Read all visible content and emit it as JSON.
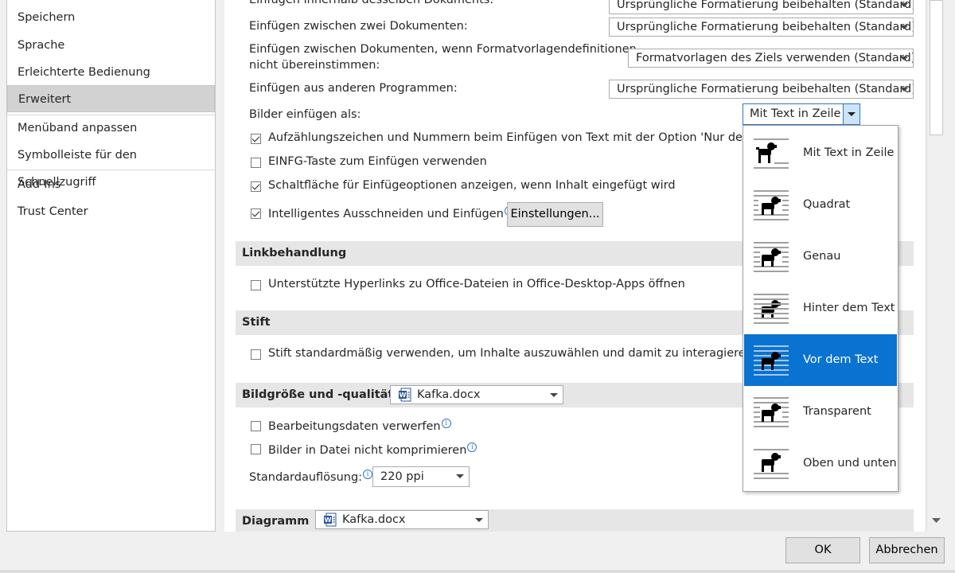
{
  "sidebar": {
    "items": [
      {
        "label": "Speichern"
      },
      {
        "label": "Sprache"
      },
      {
        "label": "Erleichterte Bedienung"
      },
      {
        "label": "Erweitert",
        "selected": true
      },
      {
        "label": "Menüband anpassen"
      },
      {
        "label": "Symbolleiste für den Schnellzugriff"
      },
      {
        "label": "Add-Ins"
      },
      {
        "label": "Trust Center"
      }
    ]
  },
  "paste": {
    "row0": {
      "label": "Einfügen innerhalb desselben Dokuments:",
      "value": "Ursprüngliche Formatierung beibehalten (Standard)"
    },
    "row1": {
      "label": "Einfügen zwischen zwei Dokumenten:",
      "value": "Ursprüngliche Formatierung beibehalten (Standard)"
    },
    "row2": {
      "label_line1": "Einfügen zwischen Dokumenten, wenn Formatvorlagendefinitionen",
      "label_line2": "nicht übereinstimmen:",
      "value": "Formatvorlagen des Ziels verwenden (Standard)"
    },
    "row3": {
      "label": "Einfügen aus anderen Programmen:",
      "value": "Ursprüngliche Formatierung beibehalten (Standard)"
    },
    "images": {
      "label": "Bilder einfügen als:",
      "value": "Mit Text in Zeile"
    },
    "chk_bullets": {
      "label": "Aufzählungszeichen und Nummern beim Einfügen von Text mit der Option 'Nur den Tex",
      "checked": true
    },
    "chk_insert": {
      "label": "EINFG-Taste zum Einfügen verwenden",
      "checked": false
    },
    "chk_button": {
      "label": "Schaltfläche für Einfügeoptionen anzeigen, wenn Inhalt eingefügt wird",
      "checked": true
    },
    "chk_smart": {
      "label": "Intelligentes Ausschneiden und Einfügen",
      "checked": true
    },
    "settings_button": "Einstellungen...",
    "info_glyph": "i"
  },
  "links": {
    "title": "Linkbehandlung",
    "chk": {
      "label": "Unterstützte Hyperlinks zu Office-Dateien in Office-Desktop-Apps öffnen",
      "checked": false
    }
  },
  "pen": {
    "title": "Stift",
    "chk": {
      "label": "Stift standardmäßig verwenden, um Inhalte auszuwählen und damit zu interagieren",
      "checked": false
    }
  },
  "imagesize": {
    "title": "Bildgröße und -qualität",
    "doc": "Kafka.docx",
    "chk_discard": {
      "label": "Bearbeitungsdaten verwerfen",
      "checked": false
    },
    "chk_compress": {
      "label": "Bilder in Datei nicht komprimieren",
      "checked": false
    },
    "resolution_label": "Standardauflösung:",
    "resolution_value": "220 ppi"
  },
  "diagram": {
    "title": "Diagramm",
    "doc": "Kafka.docx"
  },
  "wrap_dropdown": {
    "options": [
      {
        "label": "Mit Text in Zeile",
        "icon": "inline-dog-icon"
      },
      {
        "label": "Quadrat",
        "icon": "square-wrap-dog-icon"
      },
      {
        "label": "Genau",
        "icon": "tight-wrap-dog-icon"
      },
      {
        "label": "Hinter dem Text",
        "icon": "behind-text-dog-icon"
      },
      {
        "label": "Vor dem Text",
        "icon": "in-front-dog-icon",
        "highlighted": true
      },
      {
        "label": "Transparent",
        "icon": "through-wrap-dog-icon"
      },
      {
        "label": "Oben und unten",
        "icon": "top-bottom-dog-icon"
      }
    ]
  },
  "footer": {
    "ok": "OK",
    "cancel": "Abbrechen"
  },
  "colors": {
    "accent": "#0a73d2",
    "section_bg": "#e6e6e6",
    "selected_item": "#d2d2d2"
  }
}
